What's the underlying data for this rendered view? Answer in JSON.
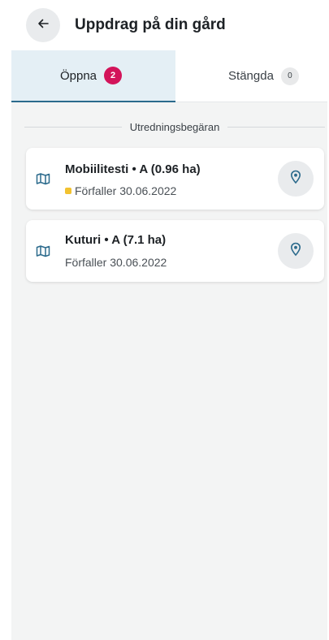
{
  "header": {
    "title": "Uppdrag på din gård",
    "back_icon": "arrow-left-icon"
  },
  "tabs": [
    {
      "label": "Öppna",
      "count": "2",
      "active": true
    },
    {
      "label": "Stängda",
      "count": "0",
      "active": false
    }
  ],
  "section": {
    "title": "Utredningsbegäran"
  },
  "cards": [
    {
      "title": "Mobiilitesti • A (0.96 ha)",
      "due": "Förfaller 30.06.2022",
      "status_color": "#f2c230",
      "icon": "map-icon",
      "action_icon": "location-pin-icon"
    },
    {
      "title": "Kuturi • A (7.1 ha)",
      "due": "Förfaller 30.06.2022",
      "icon": "map-icon",
      "action_icon": "location-pin-icon"
    }
  ],
  "colors": {
    "accent": "#2b6a8c",
    "badge_active": "#d3145a",
    "tab_active_bg": "#e4eff5",
    "content_bg": "#f3f4f4"
  }
}
